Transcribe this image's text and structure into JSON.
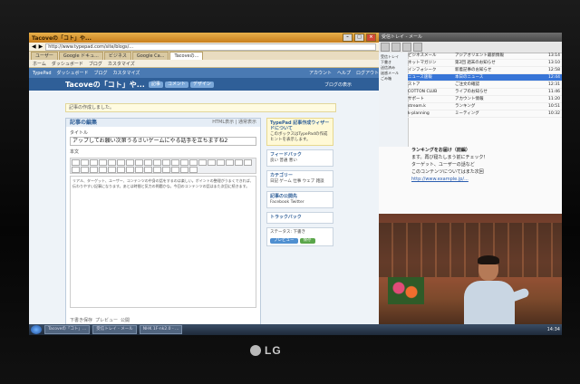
{
  "browser": {
    "title": "Tacoveの「コト」や...",
    "url": "http://www.typepad.com/site/blogs/...",
    "tabs": [
      "ユーザー",
      "Google ドキュ...",
      "ビジネス",
      "Google Ca...",
      "Tacoveの..."
    ],
    "bookmarks": [
      "ホーム",
      "ダッシュボード",
      "ブログ",
      "カスタマイズ"
    ],
    "tp_nav_left": [
      "TypePad",
      "ダッシュボード",
      "ブログ",
      "カスタマイズ"
    ],
    "tp_nav_right": [
      "アカウント",
      "ヘルプ",
      "ログアウト"
    ],
    "blog_title": "Tacoveの「コト」や...",
    "blog_pills": [
      "記事",
      "コメント",
      "デザイン"
    ],
    "blog_right": "ブログの表示",
    "notice": "記事の作成しました。",
    "editor_title": "記事の編集",
    "editor_title_right": "HTML表示 | 通常表示",
    "post_title_label": "タイトル",
    "post_title": "アップしてお願い次第うるさいゲームにやる話手を立ちますね2",
    "body_label": "本文",
    "body_text": "リアル、ターゲット、ユーザー、コンテンツの中身の話をするのは楽しい。ポイントの整理がうまくできれば、伝わりやすい記事になります。あとは時間と気力の問題かな。今回のコンテンツの話はまた次回に続きます。",
    "footer_links": [
      "下書き保存",
      "プレビュー",
      "公開"
    ],
    "side_boxes": [
      {
        "heading": "TypePad 記事作成ウィザードについて",
        "text": "このボックスはTypePadの作成ヒントを表示します。"
      },
      {
        "heading": "フィードバック",
        "text": "良い 普通 悪い"
      },
      {
        "heading": "カテゴリー",
        "text": "日記 ゲーム 仕事 ウェブ 雑談"
      },
      {
        "heading": "記事の公開先",
        "text": "Facebook Twitter"
      },
      {
        "heading": "トラックバック",
        "text": ""
      }
    ],
    "status_label": "ステータス:",
    "status_value": "下書き",
    "save_button": "保存",
    "preview_button": "プレビュー"
  },
  "mail": {
    "title": "受信トレイ - メール",
    "folders": [
      "受信トレイ",
      "下書き",
      "送信済み",
      "迷惑メール",
      "ごみ箱"
    ],
    "rows": [
      {
        "from": "ビジネスメール",
        "subject": "アジアオリエント最新情報",
        "date": "13:14"
      },
      {
        "from": "ネットマガジン",
        "subject": "第2回 週末のお知らせ",
        "date": "13:10"
      },
      {
        "from": "インフォシーク",
        "subject": "新着記事のお知らせ",
        "date": "12:58"
      },
      {
        "from": "ニュース速報",
        "subject": "本日のニュース",
        "date": "12:44"
      },
      {
        "from": "ストア",
        "subject": "ご注文の確認",
        "date": "12:31"
      },
      {
        "from": "COTTON CLUB",
        "subject": "ライブのお知らせ",
        "date": "11:46"
      },
      {
        "from": "サポート",
        "subject": "アカウント情報",
        "date": "11:20"
      },
      {
        "from": "stream.k",
        "subject": "ランキング",
        "date": "10:51"
      },
      {
        "from": "k-planning",
        "subject": "ミーティング",
        "date": "10:32"
      }
    ],
    "preview_heading": "ランキングをお届け（前編）",
    "preview_lines": [
      "ます。再び寝たしまう前にチェック！",
      "ターゲット、ユーザーの話など",
      "このコンテンツについてはまた次回"
    ],
    "preview_link": "http://www.example.jp/..."
  },
  "taskbar": {
    "items": [
      "Tacoveの「コト」...",
      "受信トレイ - メール",
      "NHK 1F-nk2.0 - ..."
    ],
    "clock": "14:34"
  },
  "monitor_brand": "LG"
}
